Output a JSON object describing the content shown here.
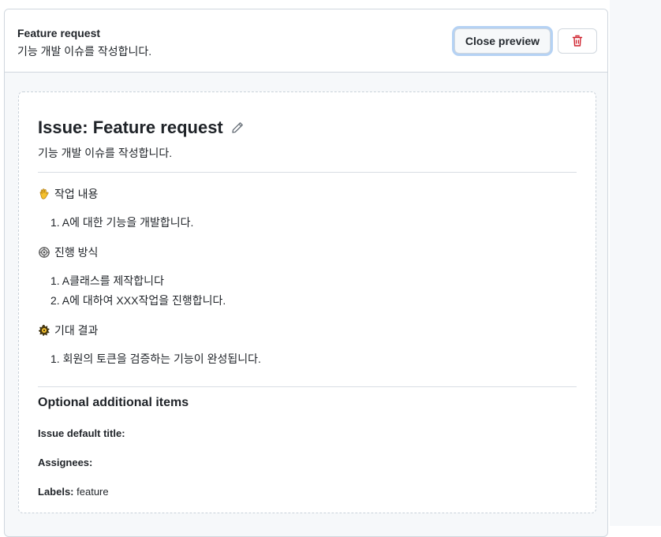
{
  "header": {
    "title": "Feature request",
    "description": "기능 개발 이슈를 작성합니다.",
    "close_preview_label": "Close preview",
    "delete_icon": "trash-icon"
  },
  "preview": {
    "title": "Issue: Feature request",
    "edit_icon": "pencil-icon",
    "description": "기능 개발 이슈를 작성합니다.",
    "sections": [
      {
        "heading": "작업 내용",
        "icon": "waving-hand-icon",
        "items": [
          "A에 대한 기능을 개발합니다."
        ]
      },
      {
        "heading": "진행 방식",
        "icon": "gear-icon",
        "items": [
          "A클래스를 제작합니다",
          "A에 대하여 XXX작업을 진행합니다."
        ]
      },
      {
        "heading": "기대 결과",
        "icon": "sparkle-gear-icon",
        "items": [
          "회원의 토큰을 검증하는 기능이 완성됩니다."
        ]
      }
    ],
    "optional": {
      "title": "Optional additional items",
      "default_title_label": "Issue default title:",
      "default_title_value": "",
      "assignees_label": "Assignees:",
      "assignees_value": "",
      "labels_label": "Labels:",
      "labels_value": "feature"
    }
  },
  "colors": {
    "danger": "#cf222e",
    "border": "#d0d7de",
    "focus_ring": "#0969da"
  }
}
